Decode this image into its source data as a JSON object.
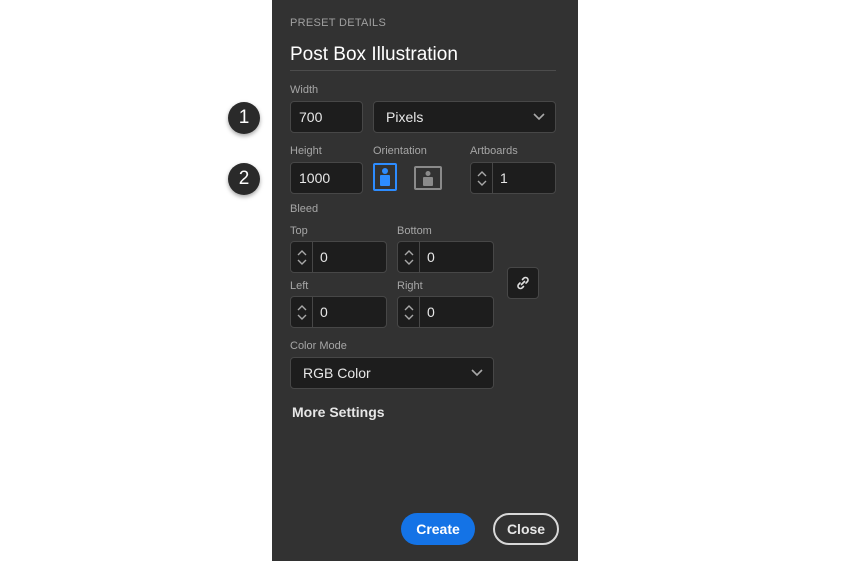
{
  "markers": [
    "1",
    "2"
  ],
  "panel": {
    "section_label": "PRESET DETAILS",
    "preset_name": "Post Box Illustration",
    "width": {
      "label": "Width",
      "value": "700",
      "unit": "Pixels"
    },
    "height": {
      "label": "Height",
      "value": "1000"
    },
    "orientation": {
      "label": "Orientation",
      "selected": "portrait"
    },
    "artboards": {
      "label": "Artboards",
      "value": "1"
    },
    "bleed": {
      "label": "Bleed",
      "top": {
        "label": "Top",
        "value": "0"
      },
      "bottom": {
        "label": "Bottom",
        "value": "0"
      },
      "left": {
        "label": "Left",
        "value": "0"
      },
      "right": {
        "label": "Right",
        "value": "0"
      },
      "link_icon": "link-icon"
    },
    "color_mode": {
      "label": "Color Mode",
      "value": "RGB Color"
    },
    "more_settings": "More Settings",
    "create_label": "Create",
    "close_label": "Close"
  },
  "colors": {
    "panel_bg": "#323232",
    "input_bg": "#1d1d1d",
    "accent": "#1473e6",
    "selected_orientation": "#2d8cff"
  }
}
